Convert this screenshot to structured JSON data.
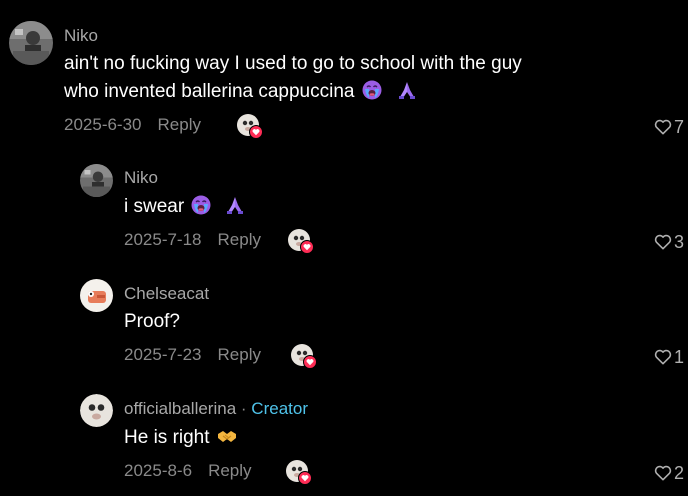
{
  "comments": [
    {
      "username": "Niko",
      "text_line1": "ain't no fucking way I used to go to school with the guy",
      "text_line2": "who invented ballerina cappuccina",
      "date": "2025-6-30",
      "reply_label": "Reply",
      "likes": "7"
    },
    {
      "username": "Niko",
      "text": "i swear",
      "date": "2025-7-18",
      "reply_label": "Reply",
      "likes": "3"
    },
    {
      "username": "Chelseacat",
      "text": "Proof?",
      "date": "2025-7-23",
      "reply_label": "Reply",
      "likes": "1"
    },
    {
      "username": "officialballerina",
      "separator": "·",
      "creator_label": "Creator",
      "text": "He is right",
      "date": "2025-8-6",
      "reply_label": "Reply",
      "likes": "2"
    }
  ],
  "colors": {
    "background": "#000000",
    "username": "#a8a8a8",
    "text": "#ffffff",
    "meta": "#8a8a8a",
    "creator_accent": "#4fc3ea",
    "heart_badge": "#fe2c55"
  },
  "icons": {
    "emoji_crying": "loudly-crying-face-emoji",
    "emoji_pray": "folded-hands-emoji",
    "emoji_handshake": "handshake-emoji",
    "like": "heart-outline-icon",
    "creator_liked": "creator-liked-badge"
  }
}
